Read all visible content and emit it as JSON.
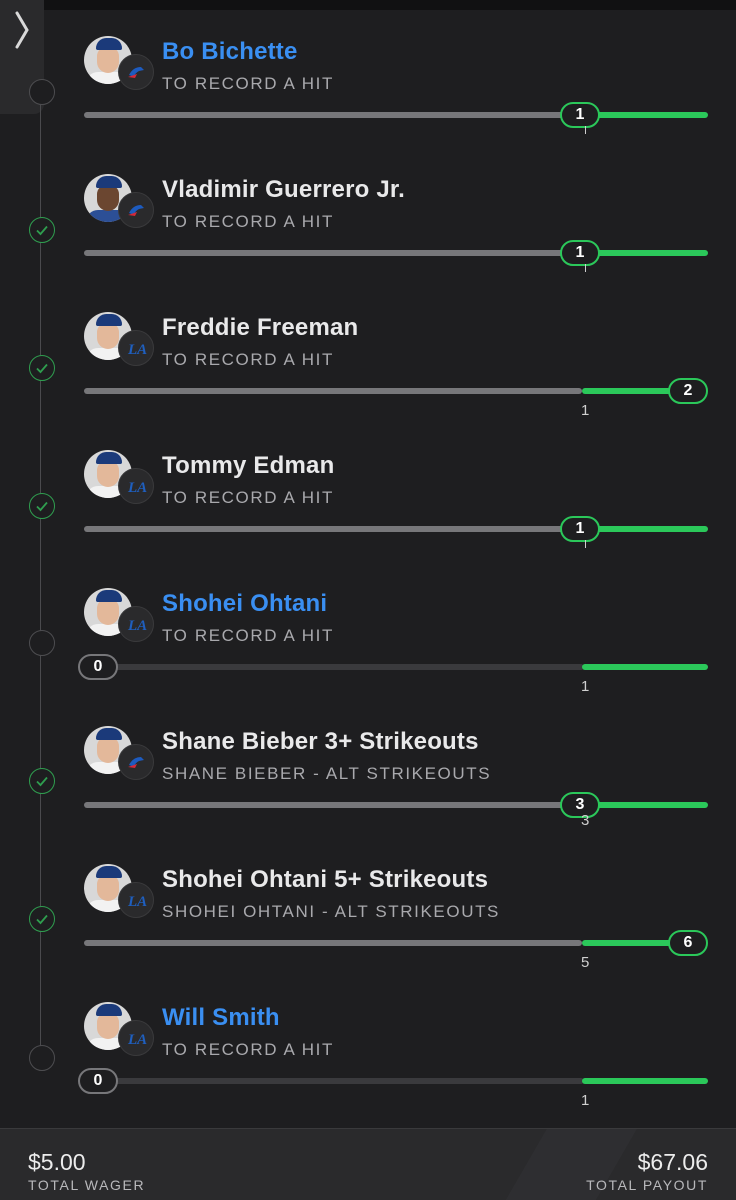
{
  "footer": {
    "total_wager": "$5.00",
    "total_wager_label": "TOTAL WAGER",
    "total_payout": "$67.06",
    "total_payout_label": "TOTAL PAYOUT"
  },
  "colors": {
    "progress_green": "#2bc85a",
    "link_blue": "#3a8ff2",
    "check_green": "#2f9e4f"
  },
  "legs": [
    {
      "player": "Bo Bichette",
      "market": "TO RECORD A HIT",
      "team": "Blue Jays",
      "current": "1",
      "target": "1",
      "settled": false,
      "highlight": true
    },
    {
      "player": "Vladimir Guerrero Jr.",
      "market": "TO RECORD A HIT",
      "team": "Blue Jays",
      "current": "1",
      "target": "1",
      "settled": true,
      "highlight": false
    },
    {
      "player": "Freddie Freeman",
      "market": "TO RECORD A HIT",
      "team": "Dodgers",
      "current": "2",
      "target": "1",
      "settled": true,
      "highlight": false
    },
    {
      "player": "Tommy Edman",
      "market": "TO RECORD A HIT",
      "team": "Dodgers",
      "current": "1",
      "target": "1",
      "settled": true,
      "highlight": false
    },
    {
      "player": "Shohei Ohtani",
      "market": "TO RECORD A HIT",
      "team": "Dodgers",
      "current": "0",
      "target": "1",
      "settled": false,
      "highlight": true
    },
    {
      "player": "Shane Bieber 3+ Strikeouts",
      "market": "SHANE BIEBER - ALT STRIKEOUTS",
      "team": "Blue Jays",
      "current": "3",
      "target": "3",
      "settled": true,
      "highlight": false
    },
    {
      "player": "Shohei Ohtani 5+ Strikeouts",
      "market": "SHOHEI OHTANI - ALT STRIKEOUTS",
      "team": "Dodgers",
      "current": "6",
      "target": "5",
      "settled": true,
      "highlight": false
    },
    {
      "player": "Will Smith",
      "market": "TO RECORD A HIT",
      "team": "Dodgers",
      "current": "0",
      "target": "1",
      "settled": false,
      "highlight": true
    }
  ]
}
